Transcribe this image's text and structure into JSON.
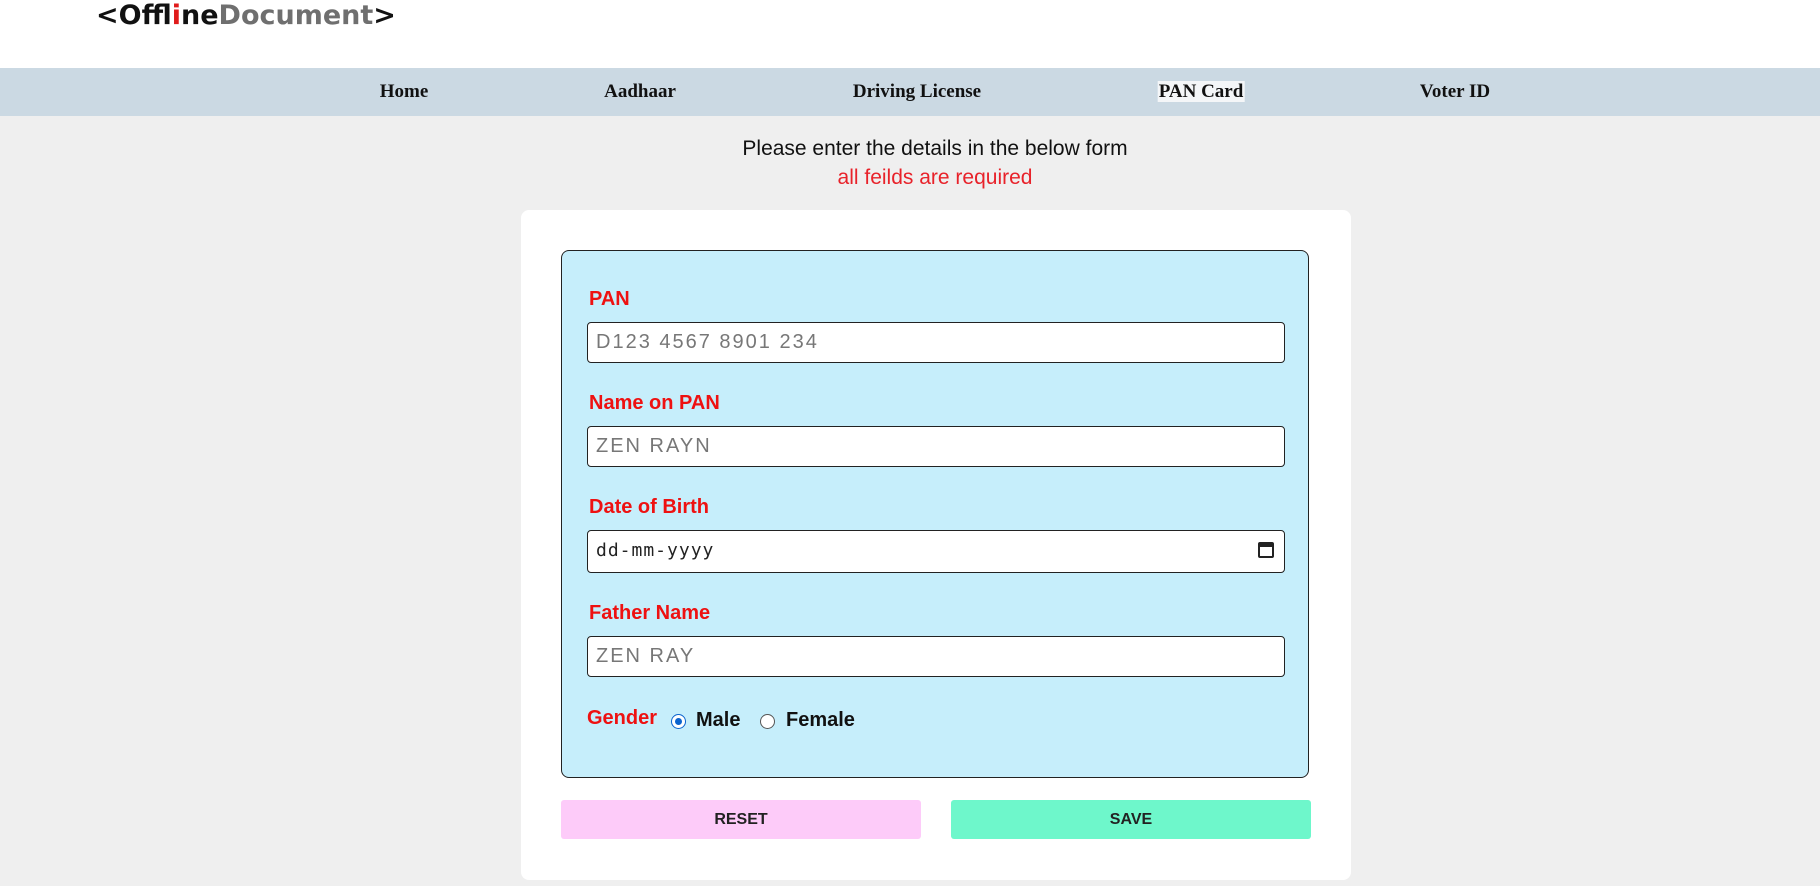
{
  "logo": {
    "part1": "<Off",
    "part2": "l",
    "part3": "i",
    "part4": "ne",
    "part5": "Document",
    "part6": ">"
  },
  "nav": {
    "items": [
      {
        "label": "Home"
      },
      {
        "label": "Aadhaar"
      },
      {
        "label": "Driving License"
      },
      {
        "label": "PAN Card",
        "active": true
      },
      {
        "label": "Voter ID"
      }
    ]
  },
  "intro": {
    "instruction": "Please enter the details in the below form",
    "required_note": "all feilds are required"
  },
  "form": {
    "pan": {
      "label": "PAN",
      "placeholder": "D123 4567 8901 234"
    },
    "name": {
      "label": "Name on PAN",
      "placeholder": "ZEN RAYN"
    },
    "dob": {
      "label": "Date of Birth",
      "value": "dd-mm-yyyy"
    },
    "father": {
      "label": "Father Name",
      "placeholder": "ZEN RAY"
    },
    "gender": {
      "label": "Gender",
      "options": [
        "Male",
        "Female"
      ],
      "selected": "Male"
    }
  },
  "buttons": {
    "reset": "RESET",
    "save": "SAVE"
  },
  "colors": {
    "accent_red": "#ee1111",
    "form_bg": "#c6eefb",
    "reset_bg": "#fdcbf9",
    "save_bg": "#6ef7cb",
    "nav_bg": "#cbd9e3"
  }
}
